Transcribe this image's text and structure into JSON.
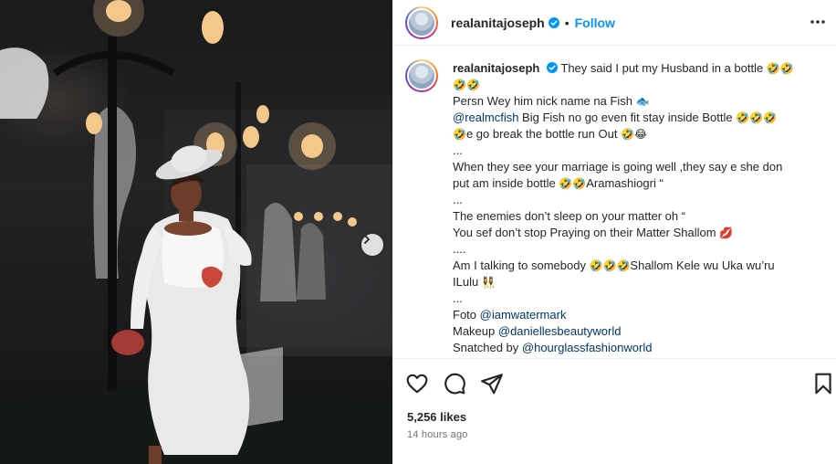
{
  "post": {
    "username": "realanitajoseph",
    "follow_label": "Follow",
    "separator": "•",
    "likes": "5,256 likes",
    "time_ago": "14 hours ago"
  },
  "caption": {
    "username": "realanitajoseph",
    "l1": "They said I put my Husband in a bottle",
    "l1_emoji": "🤣🤣",
    "l2_emoji": "🤣🤣",
    "l3": "Persn Wey him nick name na Fish",
    "l3_emoji": "🐟",
    "l4_mention": "@realmcfish",
    "l4": " Big Fish no go even fit stay inside Bottle",
    "l4_emoji": "🤣🤣🤣",
    "l5_emoji_a": "🤣",
    "l5": "e go break the bottle run Out",
    "l5_emoji_b": "🤣😂",
    "l6": "...",
    "l7": "When they see your marriage is going well ,they say e she don",
    "l8": "put am inside bottle",
    "l8_emoji": "🤣🤣",
    "l8_b": "Aramashiogri “",
    "l9": "...",
    "l10": "The enemies don’t sleep on your matter oh “",
    "l11": "You sef don’t stop Praying on their Matter Shallom",
    "l11_emoji": "💋",
    "l12": "....",
    "l13": "Am I talking to somebody",
    "l13_emoji": "🤣🤣🤣",
    "l13_b": "Shallom Kele wu Uka wu’ru",
    "l14": "ILulu",
    "l14_emoji": "👯‍♀️",
    "l15": "...",
    "l16": "Foto ",
    "l16_mention": "@iamwatermark",
    "l17": "Makeup ",
    "l17_mention": "@daniellesbeautyworld",
    "l18": "Snatched by ",
    "l18_mention": "@hourglassfashionworld"
  },
  "icons": {
    "verified": "verified-badge-icon",
    "more": "more-options-icon",
    "like": "heart-icon",
    "comment": "comment-icon",
    "share": "share-icon",
    "save": "bookmark-icon",
    "next": "chevron-right-icon"
  },
  "colors": {
    "follow": "#0095f6",
    "mention": "#00376b",
    "verified": "#0095f6",
    "text": "#262626",
    "muted": "#737373"
  }
}
